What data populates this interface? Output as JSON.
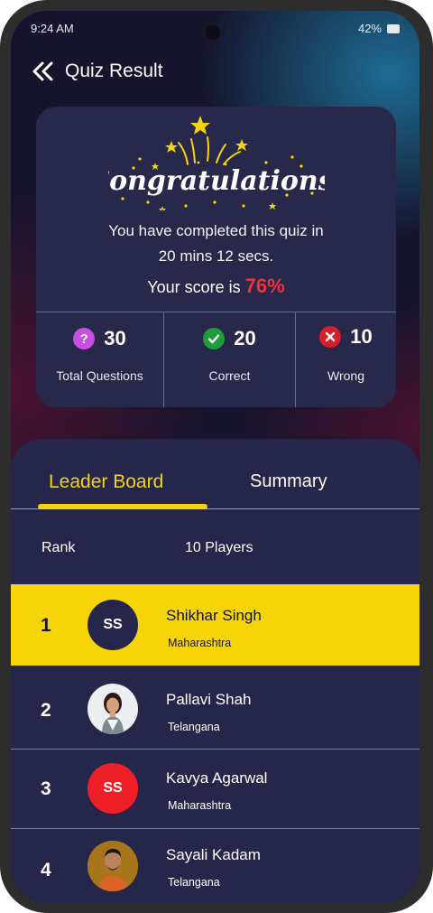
{
  "status_bar": {
    "time": "9:24 AM",
    "battery": "42%"
  },
  "header": {
    "title": "Quiz Result"
  },
  "result": {
    "congrats": "Congratulations!",
    "completed_line1": "You have completed this quiz in",
    "completed_line2": "20 mins 12 secs.",
    "score_prefix": "Your score is",
    "score_value": "76%",
    "stats": [
      {
        "value": "30",
        "label": "Total Questions",
        "icon": "question-icon",
        "color": "#c94fe0"
      },
      {
        "value": "20",
        "label": "Correct",
        "icon": "check-icon",
        "color": "#1f9d3a"
      },
      {
        "value": "10",
        "label": "Wrong",
        "icon": "cross-icon",
        "color": "#d51f2a"
      }
    ]
  },
  "tabs": [
    {
      "label": "Leader Board",
      "active": true
    },
    {
      "label": "Summary",
      "active": false
    }
  ],
  "list_header": {
    "rank": "Rank",
    "players": "10 Players"
  },
  "players": [
    {
      "rank": "1",
      "initials": "SS",
      "name": "Shikhar Singh",
      "state": "Maharashtra"
    },
    {
      "rank": "2",
      "initials": "",
      "name": "Pallavi Shah",
      "state": "Telangana"
    },
    {
      "rank": "3",
      "initials": "SS",
      "name": "Kavya Agarwal",
      "state": "Maharashtra"
    },
    {
      "rank": "4",
      "initials": "",
      "name": "Sayali Kadam",
      "state": "Telangana"
    }
  ],
  "colors": {
    "accent": "#f5d40a",
    "score": "#f0323a",
    "background": "#15142c",
    "card": "#28284a"
  }
}
